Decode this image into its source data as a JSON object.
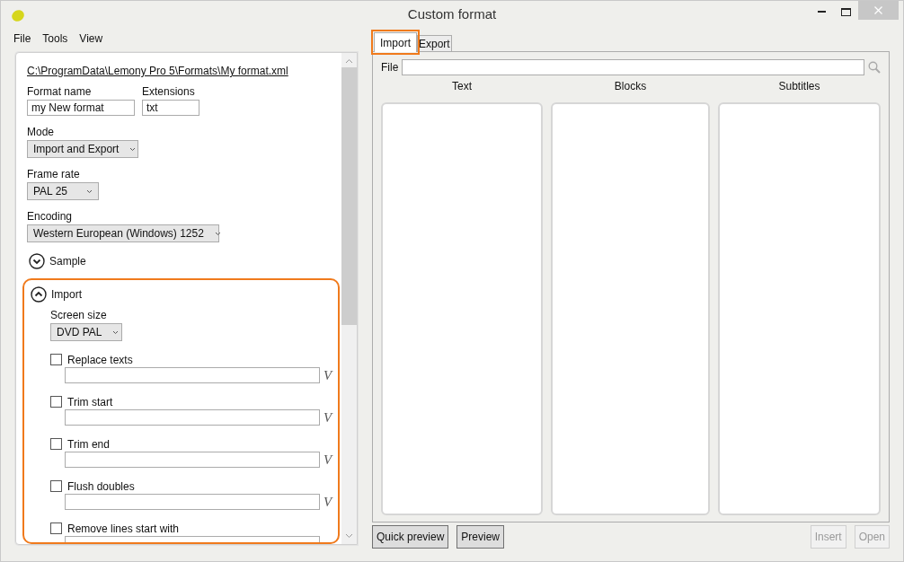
{
  "window": {
    "title": "Custom format"
  },
  "menu": [
    "File",
    "Tools",
    "View"
  ],
  "settings": {
    "path": "C:\\ProgramData\\Lemony Pro 5\\Formats\\My format.xml",
    "format_name": {
      "label": "Format name",
      "value": "my New format"
    },
    "extensions": {
      "label": "Extensions",
      "value": "txt"
    },
    "mode": {
      "label": "Mode",
      "value": "Import and Export"
    },
    "frame_rate": {
      "label": "Frame rate",
      "value": "PAL 25"
    },
    "encoding": {
      "label": "Encoding",
      "value": "Western European (Windows) 1252"
    },
    "sections": [
      {
        "title": "Sample",
        "expanded": false,
        "highlighted": false
      },
      {
        "title": "Import",
        "expanded": true,
        "highlighted": true,
        "screen_size": {
          "label": "Screen size",
          "value": "DVD PAL"
        },
        "options": [
          {
            "label": "Replace texts",
            "checked": false,
            "suffix": "V"
          },
          {
            "label": "Trim start",
            "checked": false,
            "suffix": "V"
          },
          {
            "label": "Trim end",
            "checked": false,
            "suffix": "V"
          },
          {
            "label": "Flush doubles",
            "checked": false,
            "suffix": "V"
          },
          {
            "label": "Remove lines start with",
            "checked": false
          }
        ]
      }
    ]
  },
  "tabs": [
    {
      "label": "Import",
      "selected": true,
      "highlighted": true
    },
    {
      "label": "Export",
      "selected": false,
      "highlighted": false
    }
  ],
  "file": {
    "label": "File"
  },
  "columns": [
    "Text",
    "Blocks",
    "Subtitles"
  ],
  "buttons": [
    {
      "label": "Quick preview",
      "disabled": false
    },
    {
      "label": "Preview",
      "disabled": false
    },
    {
      "label": "Insert",
      "disabled": true
    },
    {
      "label": "Open",
      "disabled": true
    }
  ]
}
